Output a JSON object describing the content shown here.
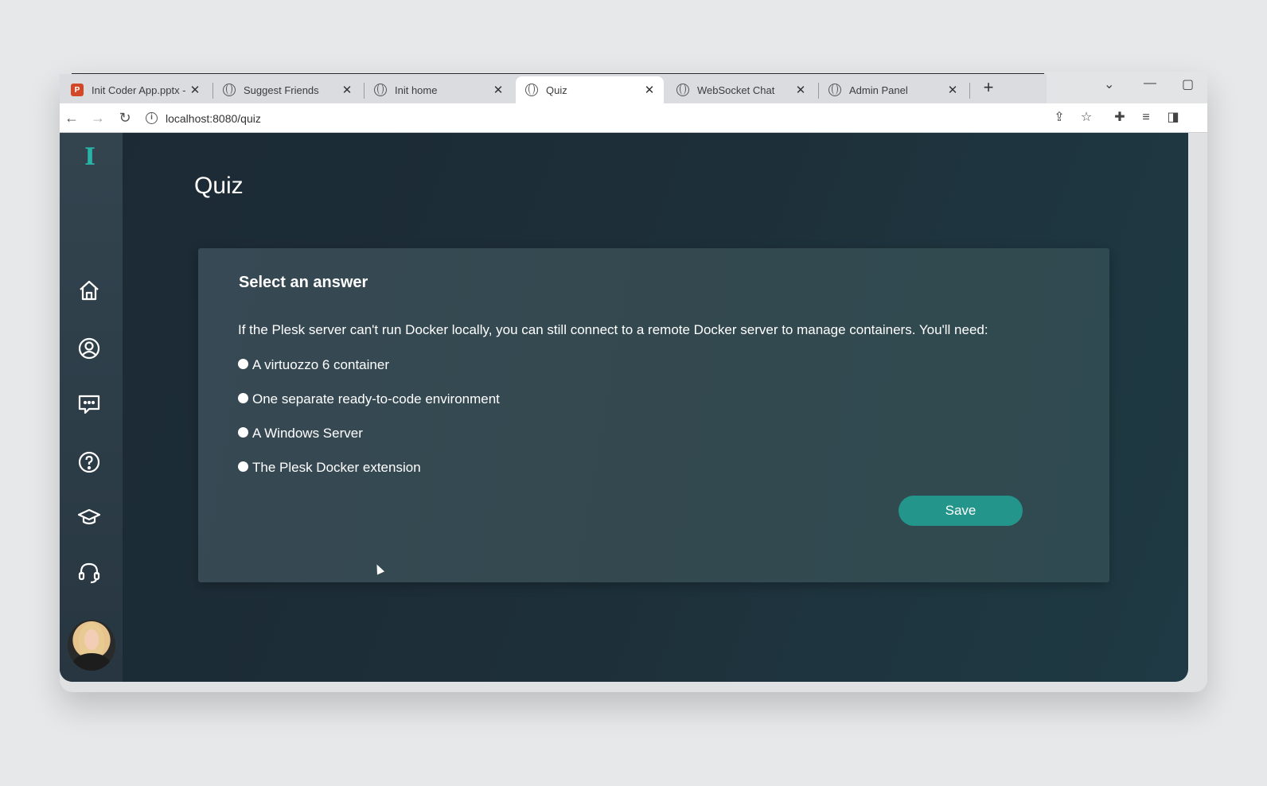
{
  "browser": {
    "tabs": [
      {
        "title": "Init Coder App.pptx -",
        "icon": "powerpoint-icon",
        "active": false
      },
      {
        "title": "Suggest Friends",
        "icon": "globe-icon",
        "active": false
      },
      {
        "title": "Init home",
        "icon": "globe-icon",
        "active": false
      },
      {
        "title": "Quiz",
        "icon": "globe-icon",
        "active": true
      },
      {
        "title": "WebSocket Chat",
        "icon": "globe-icon",
        "active": false
      },
      {
        "title": "Admin Panel",
        "icon": "globe-icon",
        "active": false
      }
    ],
    "close_glyph": "✕",
    "new_tab_glyph": "+",
    "url": "localhost:8080/quiz"
  },
  "sidebar": {
    "logo_text": "I",
    "items": [
      "home-icon",
      "profile-icon",
      "chat-icon",
      "help-icon",
      "courses-icon",
      "support-icon"
    ]
  },
  "page": {
    "title": "Quiz"
  },
  "quiz": {
    "heading": "Select an answer",
    "question": "If the Plesk server can't run Docker locally, you can still connect to a remote Docker server to manage containers. You'll need:",
    "options": [
      "A virtuozzo 6 container",
      "One separate ready-to-code environment",
      "A Windows Server",
      "The Plesk Docker extension"
    ],
    "save_label": "Save"
  },
  "colors": {
    "accent": "#23958b",
    "logo": "#29b3a7",
    "background_dark": "#1d2e38"
  }
}
